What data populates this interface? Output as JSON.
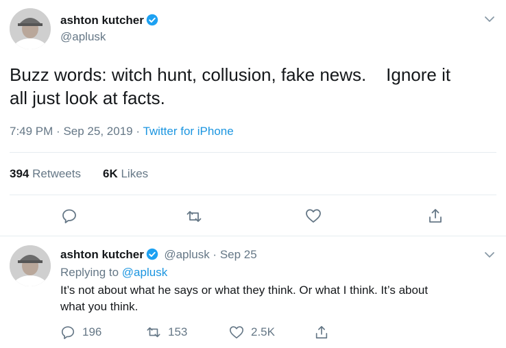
{
  "main_tweet": {
    "author_name": "ashton kutcher",
    "handle": "@aplusk",
    "text_line1": "Buzz words: witch hunt, collusion, fake news.    Ignore it",
    "text_line2": "all just look at facts.",
    "time": "7:49 PM",
    "sep1": "·",
    "date": "Sep 25, 2019",
    "sep2": "·",
    "source": "Twitter for iPhone",
    "retweet_count": "394",
    "retweet_label": "Retweets",
    "like_count": "6K",
    "like_label": "Likes"
  },
  "reply_tweet": {
    "author_name": "ashton kutcher",
    "handle_date": "@aplusk · Sep 25",
    "replying_prefix": "Replying to",
    "replying_to": "@aplusk",
    "text_line1": "It’s not about what he says or what they think. Or what I think. It’s about",
    "text_line2": "what you think.",
    "reply_count": "196",
    "retweet_count": "153",
    "like_count": "2.5K"
  },
  "icons": {
    "verified": "verified-badge-icon",
    "more": "chevron-down-icon",
    "reply": "reply-icon",
    "retweet": "retweet-icon",
    "like": "heart-icon",
    "share": "share-icon"
  },
  "colors": {
    "accent": "#1b95e0",
    "verified": "#1da1f2",
    "text": "#14171a",
    "muted": "#657786",
    "divider": "#e6ecf0"
  }
}
